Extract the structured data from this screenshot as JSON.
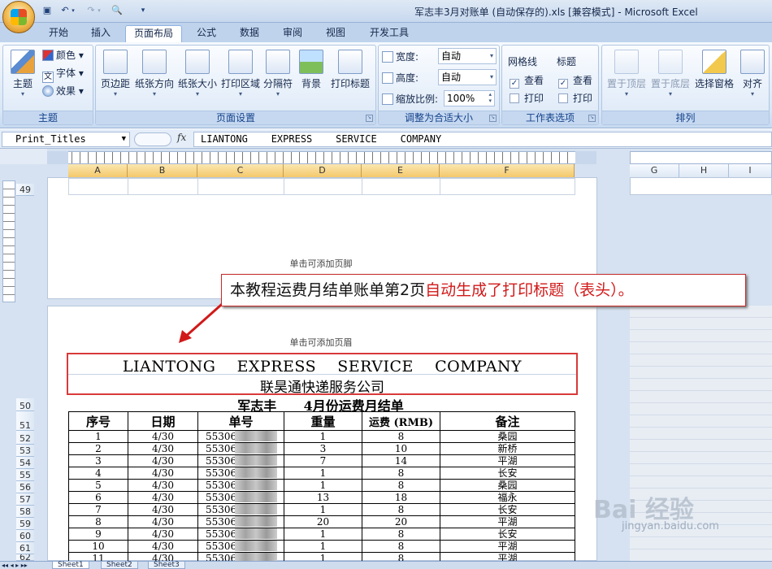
{
  "titlebar": {
    "title": "军志丰3月对账单 (自动保存的).xls  [兼容模式] - Microsoft Excel"
  },
  "tabs": [
    {
      "label": "开始"
    },
    {
      "label": "插入"
    },
    {
      "label": "页面布局",
      "active": true
    },
    {
      "label": "公式"
    },
    {
      "label": "数据"
    },
    {
      "label": "审阅"
    },
    {
      "label": "视图"
    },
    {
      "label": "开发工具"
    }
  ],
  "ribbon": {
    "theme_group": {
      "label": "主题",
      "themes": "主题",
      "colors": "颜色",
      "fonts": "字体",
      "effects": "效果"
    },
    "page_setup_group": {
      "label": "页面设置",
      "margins": "页边距",
      "orientation": "纸张方向",
      "size": "纸张大小",
      "print_area": "打印区域",
      "breaks": "分隔符",
      "background": "背景",
      "print_titles": "打印标题"
    },
    "scale_group": {
      "label": "调整为合适大小",
      "width_label": "宽度:",
      "width_value": "自动",
      "height_label": "高度:",
      "height_value": "自动",
      "scale_label": "缩放比例:",
      "scale_value": "100%"
    },
    "sheet_options_group": {
      "label": "工作表选项",
      "gridlines": "网格线",
      "headings": "标题",
      "view": "查看",
      "print": "打印"
    },
    "arrange_group": {
      "label": "排列",
      "bring_front": "置于顶层",
      "send_back": "置于底层",
      "selection_pane": "选择窗格",
      "align": "对齐"
    }
  },
  "formula_bar": {
    "name_box": "Print_Titles",
    "fx": "fx",
    "content": "LIANTONG    EXPRESS    SERVICE    COMPANY"
  },
  "columns": [
    "A",
    "B",
    "C",
    "D",
    "E",
    "F",
    "G",
    "H",
    "I"
  ],
  "rows": {
    "top": "49",
    "list": [
      "50",
      "51",
      "52",
      "53",
      "54",
      "55",
      "56",
      "57",
      "58",
      "59",
      "60",
      "61",
      "62"
    ]
  },
  "page": {
    "footer_hint": "单击可添加页脚",
    "header_hint": "单击可添加页眉"
  },
  "callout": {
    "text_normal": "本教程运费月结单账单第2页",
    "text_highlight": "自动生成了打印标题（表头）。"
  },
  "report": {
    "title_en": "LIANTONG    EXPRESS    SERVICE    COMPANY",
    "title_cn": "联昊通快递服务公司",
    "subtitle": "军志丰      4月份运费月结单",
    "headers": [
      "序号",
      "日期",
      "单号",
      "重量",
      "运费 (RMB)",
      "备注"
    ],
    "rows": [
      {
        "no": "1",
        "date": "4/30",
        "tracking": "55306",
        "weight": "1",
        "fee": "8",
        "note": "桑园"
      },
      {
        "no": "2",
        "date": "4/30",
        "tracking": "55306",
        "weight": "3",
        "fee": "10",
        "note": "新桥"
      },
      {
        "no": "3",
        "date": "4/30",
        "tracking": "55306",
        "weight": "7",
        "fee": "14",
        "note": "平湖"
      },
      {
        "no": "4",
        "date": "4/30",
        "tracking": "55306",
        "weight": "1",
        "fee": "8",
        "note": "长安"
      },
      {
        "no": "5",
        "date": "4/30",
        "tracking": "55306",
        "weight": "1",
        "fee": "8",
        "note": "桑园"
      },
      {
        "no": "6",
        "date": "4/30",
        "tracking": "55306",
        "weight": "13",
        "fee": "18",
        "note": "福永"
      },
      {
        "no": "7",
        "date": "4/30",
        "tracking": "55306",
        "weight": "1",
        "fee": "8",
        "note": "长安"
      },
      {
        "no": "8",
        "date": "4/30",
        "tracking": "55306",
        "weight": "20",
        "fee": "20",
        "note": "平湖"
      },
      {
        "no": "9",
        "date": "4/30",
        "tracking": "55306",
        "weight": "1",
        "fee": "8",
        "note": "长安"
      },
      {
        "no": "10",
        "date": "4/30",
        "tracking": "55306",
        "weight": "1",
        "fee": "8",
        "note": "平湖"
      },
      {
        "no": "11",
        "date": "4/30",
        "tracking": "55306",
        "weight": "1",
        "fee": "8",
        "note": "平湖"
      }
    ]
  },
  "sheets": [
    "Sheet1",
    "Sheet2",
    "Sheet3"
  ],
  "watermark": {
    "brand": "Bai 经验",
    "url": "jingyan.baidu.com"
  }
}
